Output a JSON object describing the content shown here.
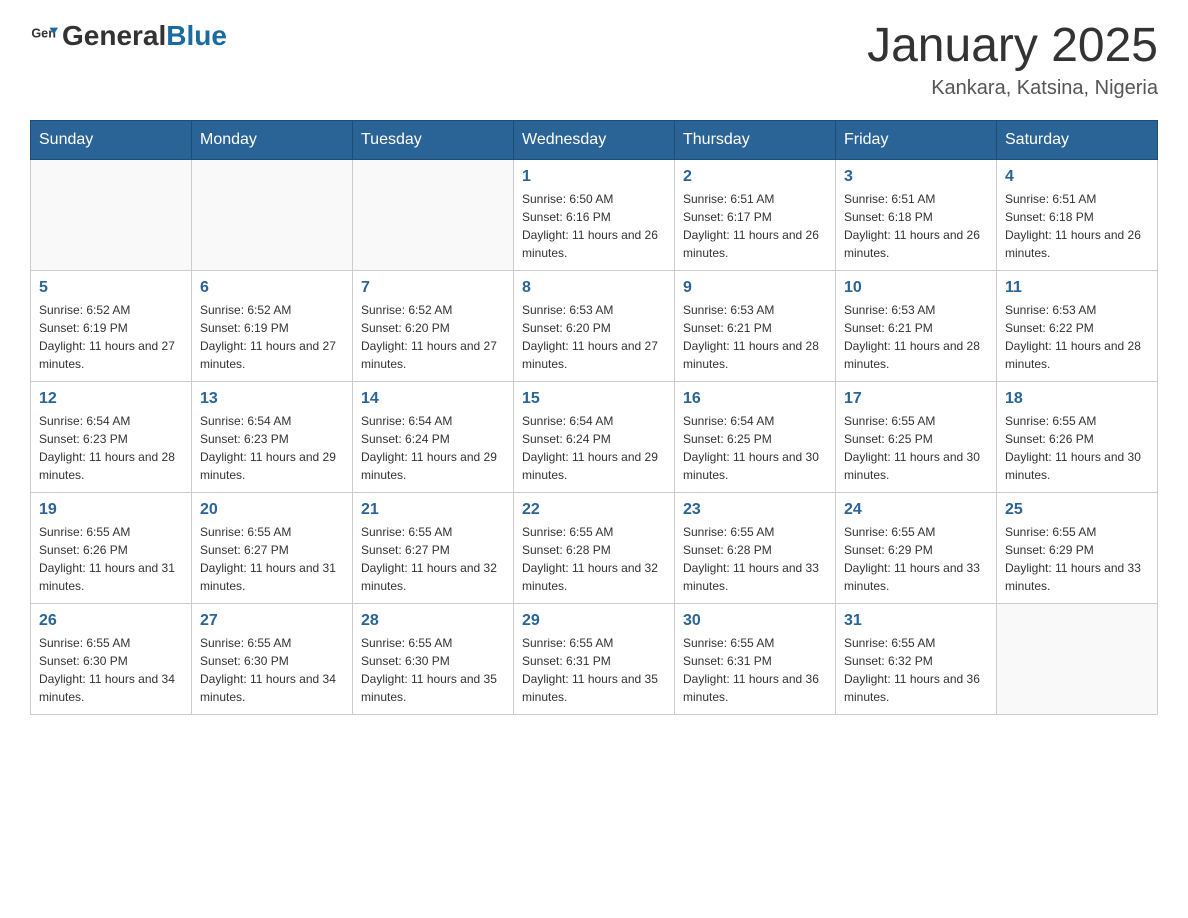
{
  "header": {
    "logo_general": "General",
    "logo_blue": "Blue",
    "title": "January 2025",
    "subtitle": "Kankara, Katsina, Nigeria"
  },
  "weekdays": [
    "Sunday",
    "Monday",
    "Tuesday",
    "Wednesday",
    "Thursday",
    "Friday",
    "Saturday"
  ],
  "weeks": [
    [
      {
        "day": "",
        "info": ""
      },
      {
        "day": "",
        "info": ""
      },
      {
        "day": "",
        "info": ""
      },
      {
        "day": "1",
        "info": "Sunrise: 6:50 AM\nSunset: 6:16 PM\nDaylight: 11 hours and 26 minutes."
      },
      {
        "day": "2",
        "info": "Sunrise: 6:51 AM\nSunset: 6:17 PM\nDaylight: 11 hours and 26 minutes."
      },
      {
        "day": "3",
        "info": "Sunrise: 6:51 AM\nSunset: 6:18 PM\nDaylight: 11 hours and 26 minutes."
      },
      {
        "day": "4",
        "info": "Sunrise: 6:51 AM\nSunset: 6:18 PM\nDaylight: 11 hours and 26 minutes."
      }
    ],
    [
      {
        "day": "5",
        "info": "Sunrise: 6:52 AM\nSunset: 6:19 PM\nDaylight: 11 hours and 27 minutes."
      },
      {
        "day": "6",
        "info": "Sunrise: 6:52 AM\nSunset: 6:19 PM\nDaylight: 11 hours and 27 minutes."
      },
      {
        "day": "7",
        "info": "Sunrise: 6:52 AM\nSunset: 6:20 PM\nDaylight: 11 hours and 27 minutes."
      },
      {
        "day": "8",
        "info": "Sunrise: 6:53 AM\nSunset: 6:20 PM\nDaylight: 11 hours and 27 minutes."
      },
      {
        "day": "9",
        "info": "Sunrise: 6:53 AM\nSunset: 6:21 PM\nDaylight: 11 hours and 28 minutes."
      },
      {
        "day": "10",
        "info": "Sunrise: 6:53 AM\nSunset: 6:21 PM\nDaylight: 11 hours and 28 minutes."
      },
      {
        "day": "11",
        "info": "Sunrise: 6:53 AM\nSunset: 6:22 PM\nDaylight: 11 hours and 28 minutes."
      }
    ],
    [
      {
        "day": "12",
        "info": "Sunrise: 6:54 AM\nSunset: 6:23 PM\nDaylight: 11 hours and 28 minutes."
      },
      {
        "day": "13",
        "info": "Sunrise: 6:54 AM\nSunset: 6:23 PM\nDaylight: 11 hours and 29 minutes."
      },
      {
        "day": "14",
        "info": "Sunrise: 6:54 AM\nSunset: 6:24 PM\nDaylight: 11 hours and 29 minutes."
      },
      {
        "day": "15",
        "info": "Sunrise: 6:54 AM\nSunset: 6:24 PM\nDaylight: 11 hours and 29 minutes."
      },
      {
        "day": "16",
        "info": "Sunrise: 6:54 AM\nSunset: 6:25 PM\nDaylight: 11 hours and 30 minutes."
      },
      {
        "day": "17",
        "info": "Sunrise: 6:55 AM\nSunset: 6:25 PM\nDaylight: 11 hours and 30 minutes."
      },
      {
        "day": "18",
        "info": "Sunrise: 6:55 AM\nSunset: 6:26 PM\nDaylight: 11 hours and 30 minutes."
      }
    ],
    [
      {
        "day": "19",
        "info": "Sunrise: 6:55 AM\nSunset: 6:26 PM\nDaylight: 11 hours and 31 minutes."
      },
      {
        "day": "20",
        "info": "Sunrise: 6:55 AM\nSunset: 6:27 PM\nDaylight: 11 hours and 31 minutes."
      },
      {
        "day": "21",
        "info": "Sunrise: 6:55 AM\nSunset: 6:27 PM\nDaylight: 11 hours and 32 minutes."
      },
      {
        "day": "22",
        "info": "Sunrise: 6:55 AM\nSunset: 6:28 PM\nDaylight: 11 hours and 32 minutes."
      },
      {
        "day": "23",
        "info": "Sunrise: 6:55 AM\nSunset: 6:28 PM\nDaylight: 11 hours and 33 minutes."
      },
      {
        "day": "24",
        "info": "Sunrise: 6:55 AM\nSunset: 6:29 PM\nDaylight: 11 hours and 33 minutes."
      },
      {
        "day": "25",
        "info": "Sunrise: 6:55 AM\nSunset: 6:29 PM\nDaylight: 11 hours and 33 minutes."
      }
    ],
    [
      {
        "day": "26",
        "info": "Sunrise: 6:55 AM\nSunset: 6:30 PM\nDaylight: 11 hours and 34 minutes."
      },
      {
        "day": "27",
        "info": "Sunrise: 6:55 AM\nSunset: 6:30 PM\nDaylight: 11 hours and 34 minutes."
      },
      {
        "day": "28",
        "info": "Sunrise: 6:55 AM\nSunset: 6:30 PM\nDaylight: 11 hours and 35 minutes."
      },
      {
        "day": "29",
        "info": "Sunrise: 6:55 AM\nSunset: 6:31 PM\nDaylight: 11 hours and 35 minutes."
      },
      {
        "day": "30",
        "info": "Sunrise: 6:55 AM\nSunset: 6:31 PM\nDaylight: 11 hours and 36 minutes."
      },
      {
        "day": "31",
        "info": "Sunrise: 6:55 AM\nSunset: 6:32 PM\nDaylight: 11 hours and 36 minutes."
      },
      {
        "day": "",
        "info": ""
      }
    ]
  ]
}
